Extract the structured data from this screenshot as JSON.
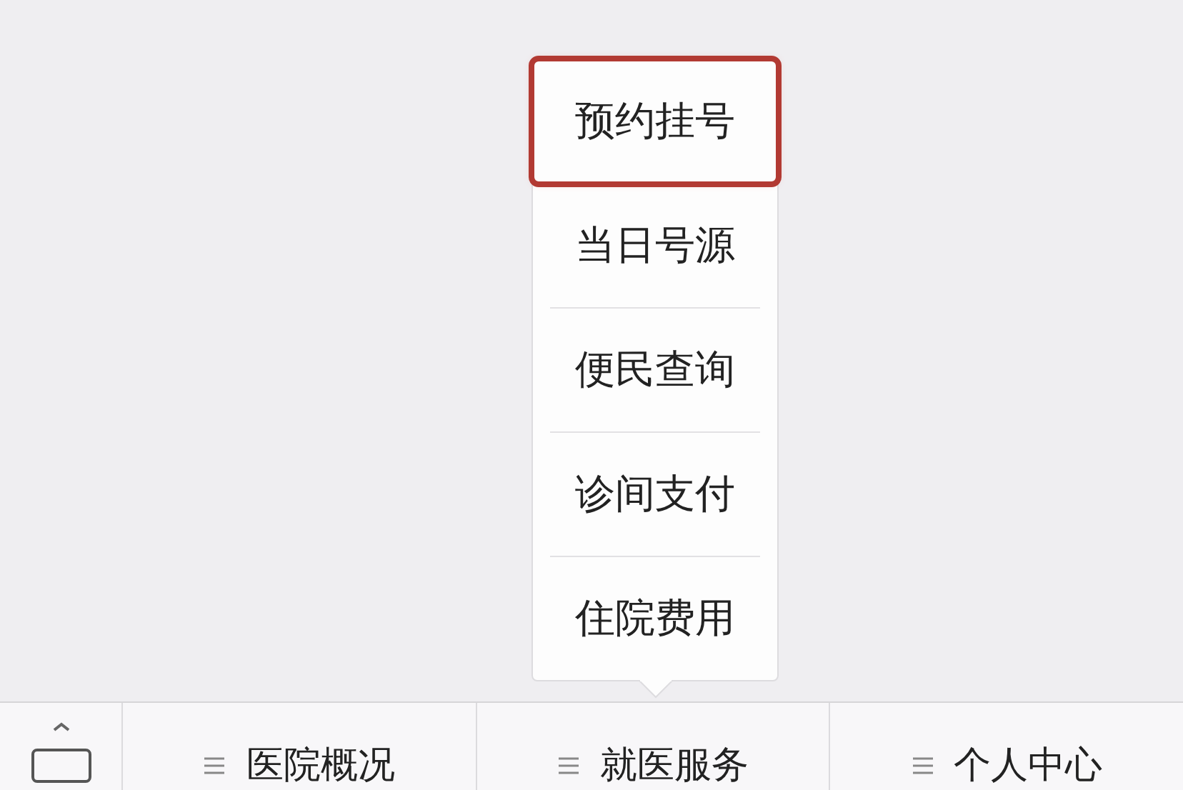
{
  "menu_bar": {
    "tabs": [
      {
        "label": "医院概况"
      },
      {
        "label": "就医服务"
      },
      {
        "label": "个人中心"
      }
    ]
  },
  "submenu": {
    "items": [
      {
        "label": "预约挂号",
        "selected": true
      },
      {
        "label": "当日号源",
        "selected": false
      },
      {
        "label": "便民查询",
        "selected": false
      },
      {
        "label": "诊间支付",
        "selected": false
      },
      {
        "label": "住院费用",
        "selected": false
      }
    ]
  }
}
